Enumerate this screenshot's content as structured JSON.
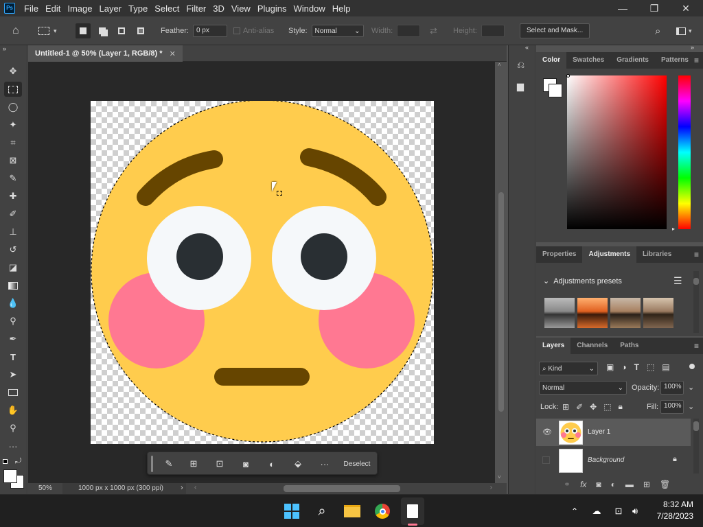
{
  "app": {
    "icon_label": "Ps"
  },
  "menu": [
    "File",
    "Edit",
    "Image",
    "Layer",
    "Type",
    "Select",
    "Filter",
    "3D",
    "View",
    "Plugins",
    "Window",
    "Help"
  ],
  "window_controls": {
    "minimize": "—",
    "maximize": "❐",
    "close": "✕"
  },
  "options": {
    "feather_label": "Feather:",
    "feather_value": "0 px",
    "antialias_label": "Anti-alias",
    "style_label": "Style:",
    "style_value": "Normal",
    "width_label": "Width:",
    "height_label": "Height:",
    "select_mask": "Select and Mask..."
  },
  "document": {
    "tab_title": "Untitled-1 @ 50% (Layer 1, RGB/8) *",
    "zoom": "50%",
    "info": "1000 px x 1000 px (300 ppi)"
  },
  "contextual_bar": {
    "deselect": "Deselect"
  },
  "color_panel": {
    "tabs": [
      "Color",
      "Swatches",
      "Gradients",
      "Patterns"
    ],
    "active_tab": "Color",
    "fg": "#ffffff",
    "bg": "#ffffff"
  },
  "adjust_panel": {
    "tabs": [
      "Properties",
      "Adjustments",
      "Libraries"
    ],
    "active_tab": "Adjustments",
    "presets_label": "Adjustments presets"
  },
  "layers_panel": {
    "tabs": [
      "Layers",
      "Channels",
      "Paths"
    ],
    "active_tab": "Layers",
    "filter": "Kind",
    "blend_mode": "Normal",
    "opacity_label": "Opacity:",
    "opacity": "100%",
    "lock_label": "Lock:",
    "fill_label": "Fill:",
    "fill": "100%",
    "layers": [
      {
        "name": "Layer 1",
        "visible": true,
        "selected": true
      },
      {
        "name": "Background",
        "visible": false,
        "selected": false,
        "locked": true
      }
    ]
  },
  "taskbar": {
    "time": "8:32 AM",
    "date": "7/28/2023"
  },
  "colors": {
    "emoji_face": "#ffcc4d",
    "brow": "#664500",
    "cheek": "#ff7892",
    "eye_white": "#f5f8fa",
    "pupil": "#292f33"
  }
}
